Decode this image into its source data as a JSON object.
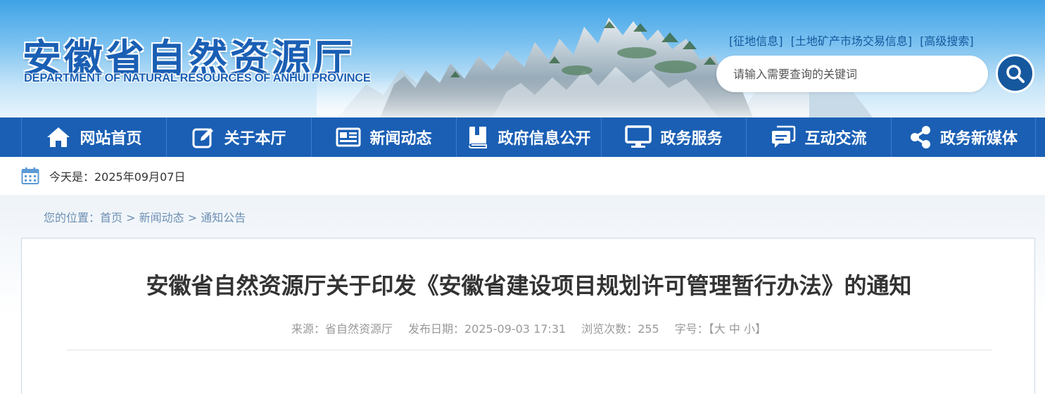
{
  "header": {
    "title": "安徽省自然资源厅",
    "subtitle": "DEPARTMENT OF NATURAL RESOURCES OF ANHUI PROVINCE",
    "top_links": [
      "[征地信息]",
      "[土地矿产市场交易信息]",
      "[高级搜索]"
    ],
    "search_placeholder": "请输入需要查询的关键词"
  },
  "nav": {
    "items": [
      {
        "label": "网站首页",
        "icon": "home-icon"
      },
      {
        "label": "关于本厅",
        "icon": "edit-icon"
      },
      {
        "label": "新闻动态",
        "icon": "news-icon"
      },
      {
        "label": "政府信息公开",
        "icon": "book-icon"
      },
      {
        "label": "政务服务",
        "icon": "monitor-icon"
      },
      {
        "label": "互动交流",
        "icon": "chat-icon"
      },
      {
        "label": "政务新媒体",
        "icon": "share-icon"
      }
    ]
  },
  "date_bar": {
    "label": "今天是：2025年09月07日",
    "icon": "calendar-icon"
  },
  "breadcrumb": {
    "prefix": "您的位置：",
    "items": [
      "首页",
      "新闻动态",
      "通知公告"
    ],
    "separator": " > "
  },
  "article": {
    "title": "安徽省自然资源厅关于印发《安徽省建设项目规划许可管理暂行办法》的通知",
    "source_label": "来源：省自然资源厅",
    "date_label": "发布日期：2025-09-03 17:31",
    "views_label": "浏览次数：255",
    "font_size_label": "字号：",
    "font_size_open": "【",
    "font_sizes": [
      "大",
      "中",
      "小"
    ],
    "font_size_close": "】"
  },
  "colors": {
    "brand_blue": "#1a5fb4",
    "link_blue": "#15589e",
    "meta_gray": "#999999",
    "title_text": "#333333"
  }
}
